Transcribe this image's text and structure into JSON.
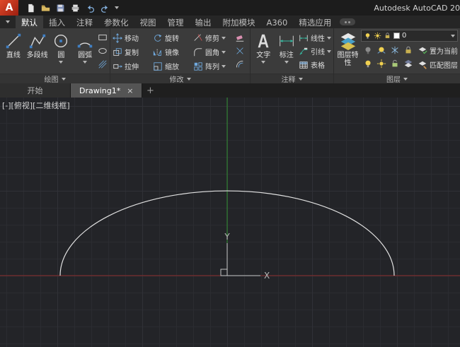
{
  "titlebar": {
    "logo_letter": "A",
    "app_title": "Autodesk AutoCAD 20",
    "qat_icons": [
      "new-file-icon",
      "open-folder-icon",
      "save-icon",
      "plot-icon",
      "undo-icon",
      "redo-icon",
      "workspace-caret"
    ]
  },
  "ribbon_tabs": [
    {
      "label": "默认",
      "active": true
    },
    {
      "label": "插入"
    },
    {
      "label": "注释"
    },
    {
      "label": "参数化"
    },
    {
      "label": "视图"
    },
    {
      "label": "管理"
    },
    {
      "label": "输出"
    },
    {
      "label": "附加模块"
    },
    {
      "label": "A360"
    },
    {
      "label": "精选应用"
    }
  ],
  "ribbon": {
    "draw": {
      "title": "绘图",
      "line": "直线",
      "polyline": "多段线",
      "circle": "圆",
      "arc": "圆弧"
    },
    "modify": {
      "title": "修改",
      "move": "移动",
      "rotate": "旋转",
      "trim": "修剪",
      "copy": "复制",
      "mirror": "镜像",
      "fillet": "圆角",
      "stretch": "拉伸",
      "scale": "缩放",
      "array": "阵列"
    },
    "annotation": {
      "title": "注释",
      "text": "文字",
      "dimension": "标注",
      "linear": "线性",
      "leader": "引线",
      "table": "表格"
    },
    "layers": {
      "title": "图层",
      "properties": "图层特性",
      "set_current": "置为当前",
      "match_layer": "匹配图层",
      "layer_name": "0"
    }
  },
  "file_tabs": {
    "start": "开始",
    "drawing": "Drawing1*",
    "close": "×",
    "new_tab": "+"
  },
  "viewport": {
    "controls_label": "[-][俯视][二维线框]",
    "ucs": {
      "x": "X",
      "y": "Y"
    }
  },
  "colors": {
    "axis_x": "#8b2c2c",
    "axis_y": "#2f8f2f",
    "curve": "#e2e2e2",
    "ucs": "#c2c2c2",
    "viewport_bg": "#232428",
    "grid_minor": "#2b2c31",
    "grid_major": "#303137",
    "logo_red": "#c8381e"
  }
}
